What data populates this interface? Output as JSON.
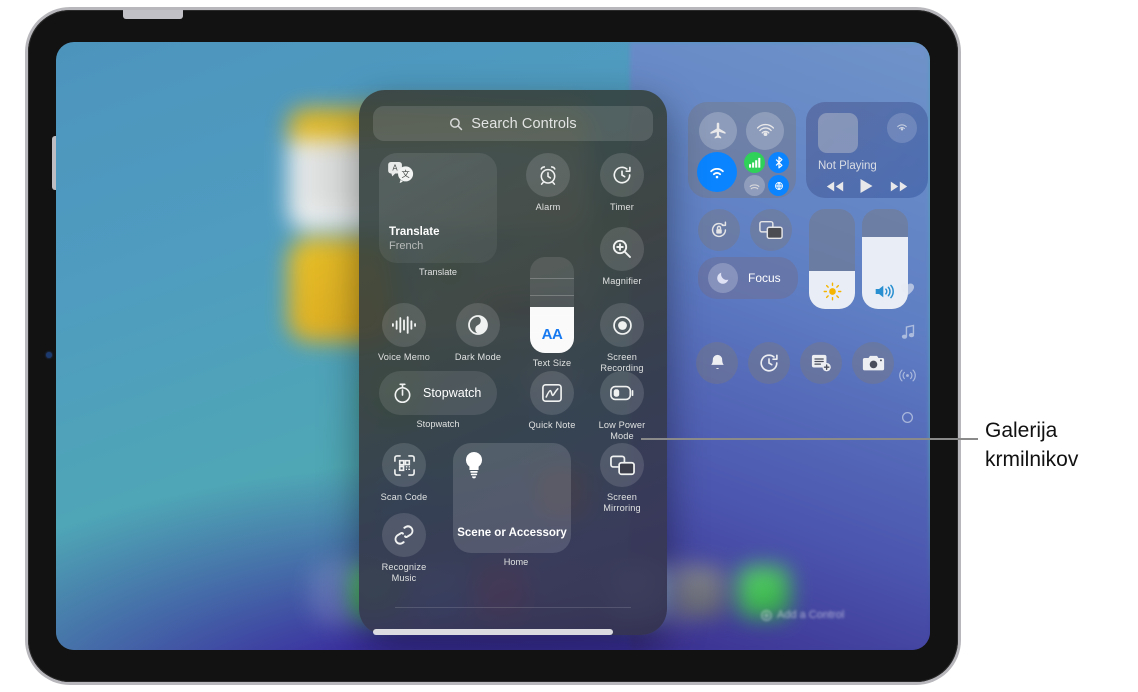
{
  "callout": {
    "text": "Galerija krmilnikov"
  },
  "gallery": {
    "search": {
      "placeholder": "Search Controls",
      "icon": "search-icon"
    },
    "items": [
      {
        "id": "translate",
        "label": "Translate",
        "tile_title": "Translate",
        "tile_subtitle": "French",
        "icon": "translate-icon",
        "kind": "tile"
      },
      {
        "id": "alarm",
        "label": "Alarm",
        "icon": "alarm-clock-icon",
        "kind": "round"
      },
      {
        "id": "timer",
        "label": "Timer",
        "icon": "timer-icon",
        "kind": "round"
      },
      {
        "id": "magnifier",
        "label": "Magnifier",
        "icon": "magnifier-icon",
        "kind": "round"
      },
      {
        "id": "voice-memo",
        "label": "Voice Memo",
        "icon": "waveform-icon",
        "kind": "round"
      },
      {
        "id": "dark-mode",
        "label": "Dark Mode",
        "icon": "dark-mode-circle-icon",
        "kind": "round"
      },
      {
        "id": "text-size",
        "label": "Text Size",
        "icon": "text-size-aa-icon",
        "kind": "slider",
        "glyph": "AA"
      },
      {
        "id": "screen-recording",
        "label": "Screen Recording",
        "icon": "record-icon",
        "kind": "round"
      },
      {
        "id": "stopwatch",
        "label": "Stopwatch",
        "tile_title": "Stopwatch",
        "icon": "stopwatch-icon",
        "kind": "pill"
      },
      {
        "id": "quick-note",
        "label": "Quick Note",
        "icon": "quick-note-icon",
        "kind": "round"
      },
      {
        "id": "low-power-mode",
        "label": "Low Power Mode",
        "icon": "battery-low-icon",
        "kind": "round"
      },
      {
        "id": "scan-code",
        "label": "Scan Code",
        "icon": "qr-scan-icon",
        "kind": "round"
      },
      {
        "id": "home",
        "label": "Home",
        "tile_title": "Scene or Accessory",
        "icon": "lightbulb-icon",
        "kind": "tile"
      },
      {
        "id": "screen-mirroring",
        "label": "Screen Mirroring",
        "icon": "screen-mirroring-icon",
        "kind": "round"
      },
      {
        "id": "recognize-music",
        "label": "Recognize Music",
        "icon": "shazam-icon",
        "kind": "round"
      }
    ]
  },
  "control_center": {
    "connectivity": {
      "airplane_mode": {
        "name": "airplane-mode-toggle",
        "state": "off"
      },
      "airdrop": {
        "name": "airdrop-toggle",
        "state": "off"
      },
      "wifi": {
        "name": "wifi-toggle",
        "state": "on",
        "color": "#0a84ff"
      },
      "cellular": {
        "name": "cellular-toggle",
        "state": "on",
        "color": "#30d158"
      },
      "bluetooth": {
        "name": "bluetooth-toggle",
        "state": "on",
        "color": "#0a84ff"
      },
      "hotspot": {
        "name": "personal-hotspot-toggle",
        "state": "off"
      },
      "satellite": {
        "name": "satellite-toggle",
        "state": "on",
        "color": "#0a84ff"
      }
    },
    "now_playing": {
      "status": "Not Playing",
      "airplay": "airplay-icon",
      "prev": "rewind-icon",
      "play": "play-icon",
      "next": "fast-forward-icon"
    },
    "rotation_lock": {
      "label": "rotation-lock-toggle"
    },
    "screen_mirroring": {
      "label": "screen-mirroring-button"
    },
    "focus": {
      "label": "Focus",
      "icon": "moon-icon"
    },
    "brightness": {
      "icon": "sun-icon",
      "value_percent": 38
    },
    "volume": {
      "icon": "speaker-icon",
      "value_percent": 72
    },
    "bottom_row": [
      {
        "id": "silent-mode",
        "icon": "bell-icon"
      },
      {
        "id": "timer",
        "icon": "timer-icon"
      },
      {
        "id": "new-note",
        "icon": "note-plus-icon"
      },
      {
        "id": "camera",
        "icon": "camera-icon"
      }
    ],
    "edge_icons": [
      {
        "id": "health",
        "icon": "heart-icon"
      },
      {
        "id": "music",
        "icon": "music-note-icon"
      },
      {
        "id": "connectivity",
        "icon": "broadcast-icon"
      },
      {
        "id": "more",
        "icon": "circle-icon"
      }
    ],
    "add_control": {
      "label": "Add a Control",
      "icon": "plus-circle-icon"
    }
  }
}
